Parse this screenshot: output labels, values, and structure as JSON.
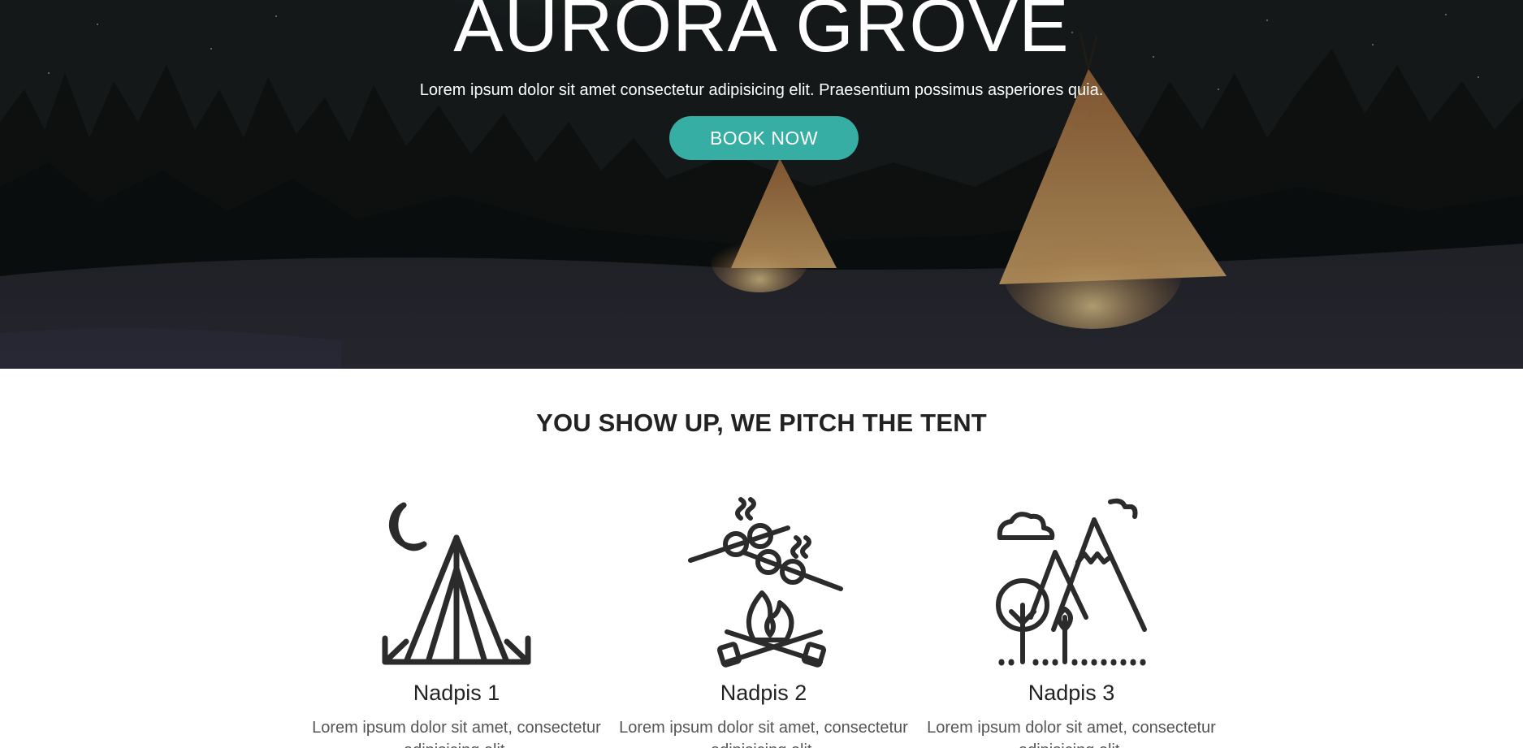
{
  "hero": {
    "title": "AURORA GROVE",
    "subtitle": "Lorem ipsum dolor sit amet consectetur adipisicing elit. Praesentium possimus asperiores quia.",
    "cta_label": "BOOK NOW",
    "cta_color": "#36aea4"
  },
  "features": {
    "heading": "YOU SHOW UP, WE PITCH THE TENT",
    "items": [
      {
        "icon": "tent-moon-icon",
        "title": "Nadpis 1",
        "text": "Lorem ipsum dolor sit amet, consectetur adipisicing elit."
      },
      {
        "icon": "campfire-skewer-icon",
        "title": "Nadpis 2",
        "text": "Lorem ipsum dolor sit amet, consectetur adipisicing elit."
      },
      {
        "icon": "mountains-trees-icon",
        "title": "Nadpis 3",
        "text": "Lorem ipsum dolor sit amet, consectetur adipisicing elit."
      }
    ]
  }
}
